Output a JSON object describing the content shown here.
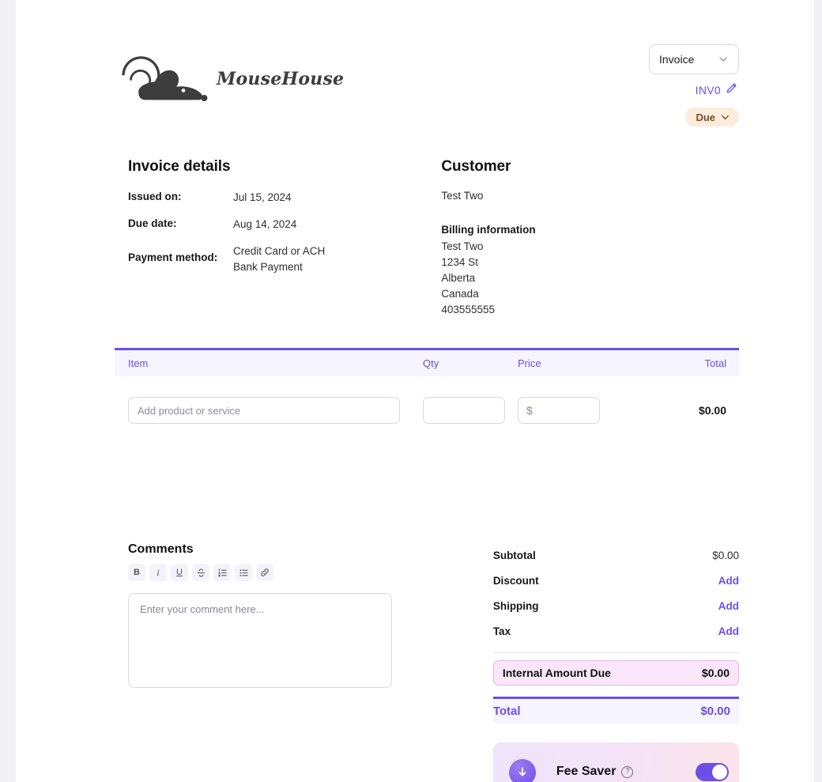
{
  "brand": {
    "name": "MouseHouse",
    "logo_icon": "mouse-logo-icon"
  },
  "header": {
    "doc_type_selected": "Invoice",
    "doc_type_chevron_icon": "chevron-down-icon",
    "invoice_number": "INV0",
    "edit_icon": "pencil-icon",
    "status_label": "Due",
    "status_chevron_icon": "chevron-down-icon",
    "status_bg": "#fbecdc",
    "status_text_color": "#7d4b2a"
  },
  "invoice_details": {
    "title": "Invoice details",
    "rows": [
      {
        "label": "Issued on:",
        "value": "Jul 15, 2024"
      },
      {
        "label": "Due date:",
        "value": "Aug 14, 2024"
      }
    ],
    "payment_label": "Payment method:",
    "payment_line1": "Credit Card or ACH",
    "payment_line2": "Bank Payment"
  },
  "customer": {
    "title": "Customer",
    "name": "Test Two",
    "billing_title": "Billing information",
    "billing_lines": [
      "Test Two",
      "1234 St",
      "Alberta",
      "Canada",
      "403555555"
    ]
  },
  "items_table": {
    "accent_color": "#6c4ee8",
    "header_bg": "#f6f4fe",
    "columns": {
      "item": "Item",
      "qty": "Qty",
      "price": "Price",
      "total": "Total"
    },
    "row": {
      "item_placeholder": "Add product or service",
      "item_value": "",
      "qty_value": "",
      "price_prefix": "$",
      "price_value": "",
      "line_total": "$0.00"
    }
  },
  "comments": {
    "title": "Comments",
    "toolbar": [
      {
        "name": "bold",
        "glyph": "B"
      },
      {
        "name": "italic",
        "glyph": "i"
      },
      {
        "name": "underline",
        "glyph": "U"
      },
      {
        "name": "strikethrough",
        "glyph": "S"
      },
      {
        "name": "ordered-list",
        "glyph": ""
      },
      {
        "name": "unordered-list",
        "glyph": ""
      },
      {
        "name": "link",
        "glyph": ""
      }
    ],
    "placeholder": "Enter your comment here...",
    "value": ""
  },
  "totals": {
    "subtotal_label": "Subtotal",
    "subtotal_value": "$0.00",
    "discount_label": "Discount",
    "discount_action": "Add",
    "shipping_label": "Shipping",
    "shipping_action": "Add",
    "tax_label": "Tax",
    "tax_action": "Add",
    "internal_label": "Internal Amount Due",
    "internal_value": "$0.00",
    "internal_bg": "#f9e6fa",
    "internal_border": "#e7b4e8",
    "total_label": "Total",
    "total_value": "$0.00",
    "total_color": "#6d4ee8"
  },
  "fee_saver": {
    "label": "Fee Saver",
    "help_icon": "question-mark-icon",
    "help_glyph": "?",
    "badge_icon": "fee-saver-badge-icon",
    "toggle_on": true,
    "toggle_color": "#6c4ee8"
  }
}
